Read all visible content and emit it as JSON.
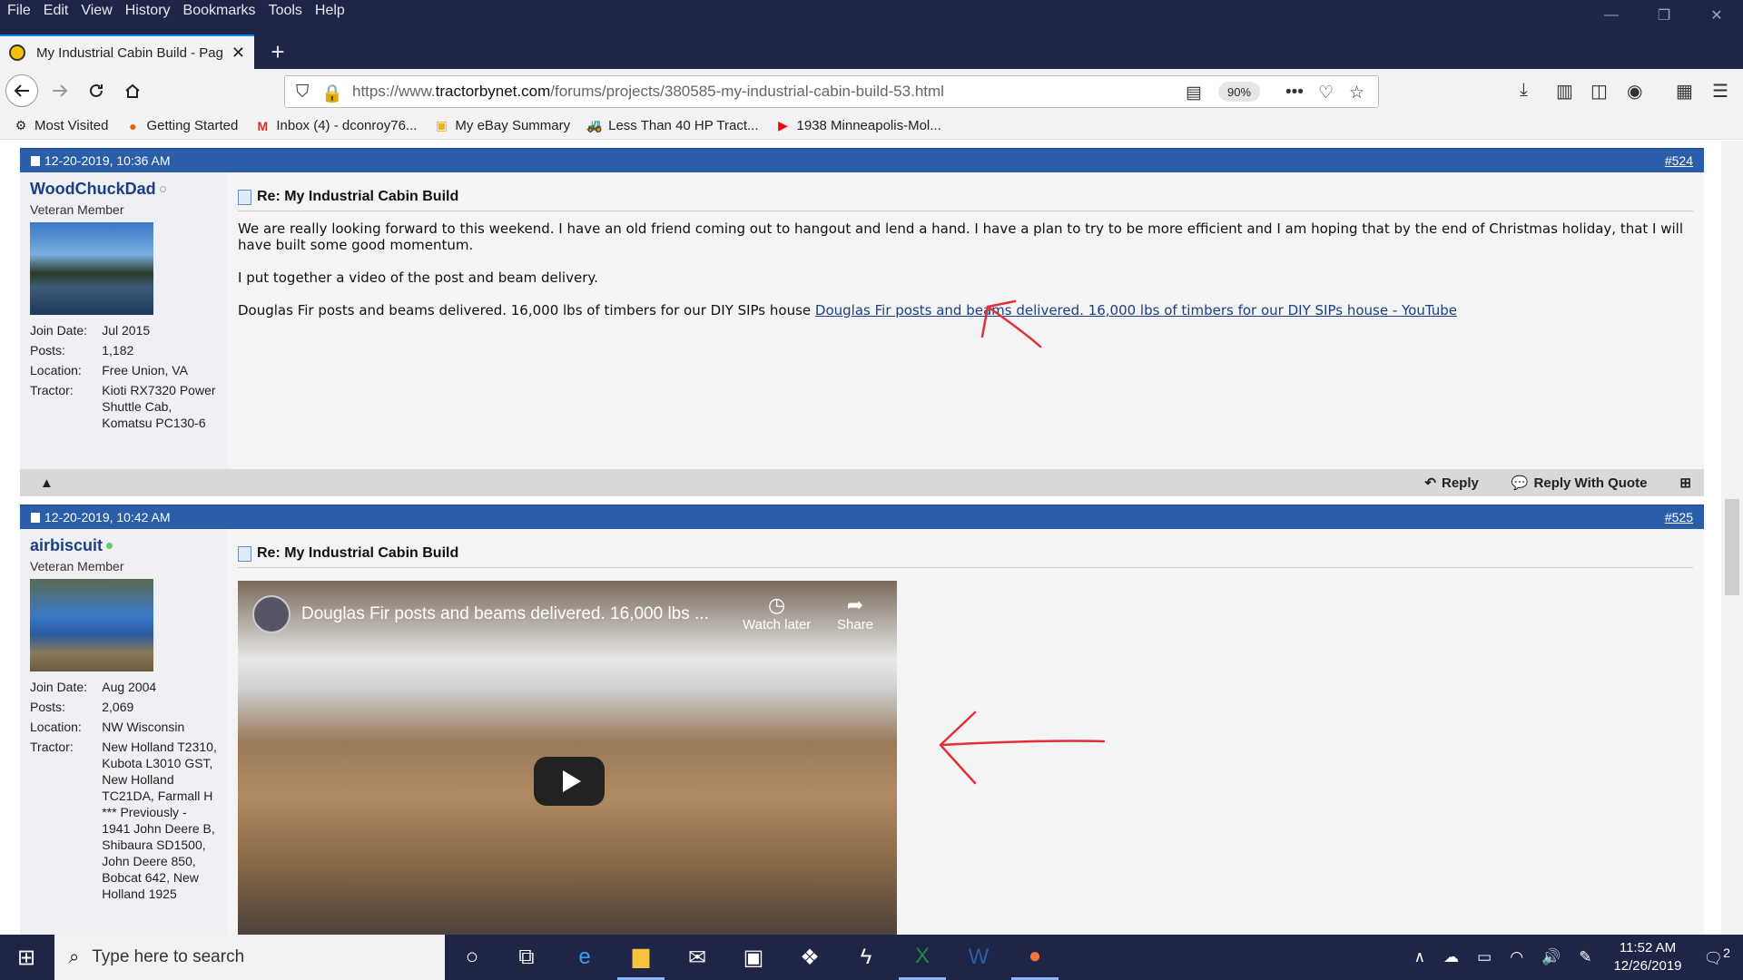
{
  "menu": [
    "File",
    "Edit",
    "View",
    "History",
    "Bookmarks",
    "Tools",
    "Help"
  ],
  "window_controls": {
    "minimize": "—",
    "restore": "❐",
    "close": "✕"
  },
  "tab": {
    "title": "My Industrial Cabin Build - Pag",
    "close": "✕",
    "new_tab": "+"
  },
  "navbar": {
    "url_prefix": "https://www.",
    "url_domain": "tractorbynet.com",
    "url_path": "/forums/projects/380585-my-industrial-cabin-build-53.html",
    "zoom": "90%"
  },
  "bookmarks": [
    {
      "label": "Most Visited",
      "icon": "gear-icon"
    },
    {
      "label": "Getting Started",
      "icon": "firefox-icon"
    },
    {
      "label": "Inbox (4) - dconroy76...",
      "icon": "gmail-icon"
    },
    {
      "label": "My eBay Summary",
      "icon": "ebay-icon"
    },
    {
      "label": "Less Than 40 HP Tract...",
      "icon": "tractor-icon"
    },
    {
      "label": "1938 Minneapolis-Mol...",
      "icon": "youtube-icon"
    }
  ],
  "posts": [
    {
      "date": "12-20-2019, 10:36 AM",
      "number": "#524",
      "username": "WoodChuckDad",
      "user_title": "Veteran Member",
      "info": [
        {
          "k": "Join Date:",
          "v": "Jul 2015"
        },
        {
          "k": "Posts:",
          "v": "1,182"
        },
        {
          "k": "Location:",
          "v": "Free Union, VA"
        },
        {
          "k": "Tractor:",
          "v": "Kioti RX7320 Power Shuttle Cab, Komatsu PC130-6"
        }
      ],
      "title": "Re: My Industrial Cabin Build",
      "p1": "We are really looking forward to this weekend. I have an old friend coming out to hangout and lend a hand. I have a plan to try to be more efficient and I am hoping that by the end of Christmas holiday, that I will have built some good momentum.",
      "p2": "I put together a video of the post and beam delivery.",
      "p3": "Douglas Fir posts and beams delivered. 16,000 lbs of timbers for our DIY SIPs house",
      "link": "Douglas Fir posts and beams delivered. 16,000 lbs of timbers for our DIY SIPs house - YouTube",
      "footer": {
        "reply": "Reply",
        "quote": "Reply With Quote"
      }
    },
    {
      "date": "12-20-2019, 10:42 AM",
      "number": "#525",
      "username": "airbiscuit",
      "user_title": "Veteran Member",
      "info": [
        {
          "k": "Join Date:",
          "v": "Aug 2004"
        },
        {
          "k": "Posts:",
          "v": "2,069"
        },
        {
          "k": "Location:",
          "v": "NW Wisconsin"
        },
        {
          "k": "Tractor:",
          "v": "New Holland T2310, Kubota L3010 GST, New Holland TC21DA, Farmall H *** Previously - 1941 John Deere B, Shibaura SD1500, John Deere 850, Bobcat 642, New Holland 1925"
        }
      ],
      "title": "Re: My Industrial Cabin Build",
      "video": {
        "title": "Douglas Fir posts and beams delivered. 16,000 lbs ...",
        "watch_later": "Watch later",
        "share": "Share"
      }
    }
  ],
  "taskbar": {
    "search_placeholder": "Type here to search",
    "time": "11:52 AM",
    "date": "12/26/2019",
    "notifications": "2"
  },
  "colors": {
    "header_blue": "#2b5ea8",
    "title_bar": "#1f2547",
    "annotation_red": "#e0303a"
  }
}
